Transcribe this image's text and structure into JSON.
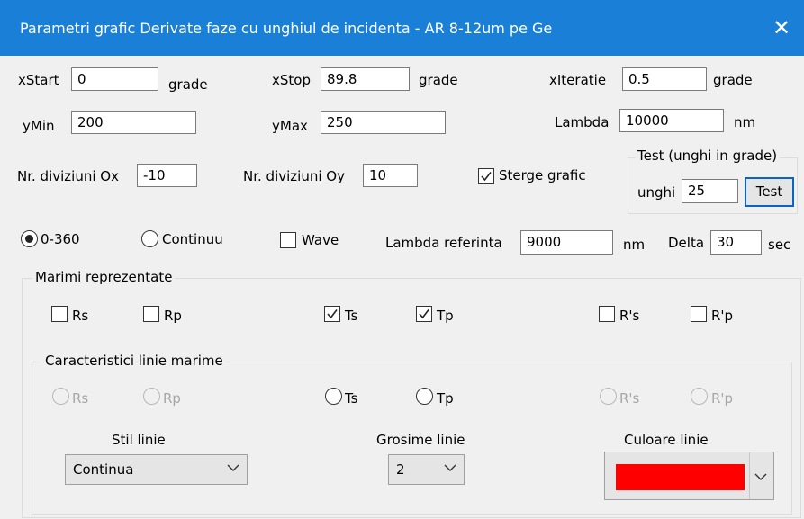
{
  "window": {
    "title": "Parametri grafic Derivate faze cu unghiul de incidenta - AR 8-12um pe Ge",
    "close_icon": "close-icon"
  },
  "row1": {
    "xstart_label": "xStart",
    "xstart_value": "0",
    "xstart_unit": "grade",
    "xstop_label": "xStop",
    "xstop_value": "89.8",
    "xstop_unit": "grade",
    "xiteratie_label": "xIteratie",
    "xiteratie_value": "0.5",
    "xiteratie_unit": "grade"
  },
  "row2": {
    "ymin_label": "yMin",
    "ymin_value": "200",
    "ymax_label": "yMax",
    "ymax_value": "250",
    "lambda_label": "Lambda",
    "lambda_value": "10000",
    "lambda_unit": "nm"
  },
  "row3": {
    "div_ox_label": "Nr. diviziuni Ox",
    "div_ox_value": "-10",
    "div_oy_label": "Nr. diviziuni Oy",
    "div_oy_value": "10",
    "sterge_label": "Sterge grafic",
    "sterge_checked": true
  },
  "test": {
    "title": "Test (unghi in grade)",
    "unghi_label": "unghi",
    "unghi_value": "25",
    "button_label": "Test"
  },
  "row4": {
    "r0360_label": "0-360",
    "continuu_label": "Continuu",
    "wave_label": "Wave",
    "lambda_ref_label": "Lambda referinta",
    "lambda_ref_value": "9000",
    "lambda_ref_unit": "nm",
    "delta_label": "Delta",
    "delta_value": "30",
    "delta_unit": "sec"
  },
  "marimi": {
    "title": "Marimi reprezentate",
    "items": [
      {
        "label": "Rs",
        "checked": false
      },
      {
        "label": "Rp",
        "checked": false
      },
      {
        "label": "Ts",
        "checked": true
      },
      {
        "label": "Tp",
        "checked": true
      },
      {
        "label": "R's",
        "checked": false
      },
      {
        "label": "R'p",
        "checked": false
      }
    ]
  },
  "caracteristici": {
    "title": "Caracteristici linie marime",
    "items": [
      {
        "label": "Rs",
        "enabled": false
      },
      {
        "label": "Rp",
        "enabled": false
      },
      {
        "label": "Ts",
        "enabled": true
      },
      {
        "label": "Tp",
        "enabled": true
      },
      {
        "label": "R's",
        "enabled": false
      },
      {
        "label": "R'p",
        "enabled": false
      }
    ],
    "stil_label": "Stil linie",
    "stil_value": "Continua",
    "grosime_label": "Grosime linie",
    "grosime_value": "2",
    "culoare_label": "Culoare linie",
    "culoare_value": "#ff0000"
  },
  "colors": {
    "titlebar": "#1a7fd6",
    "focus_border": "#0a64c8"
  }
}
